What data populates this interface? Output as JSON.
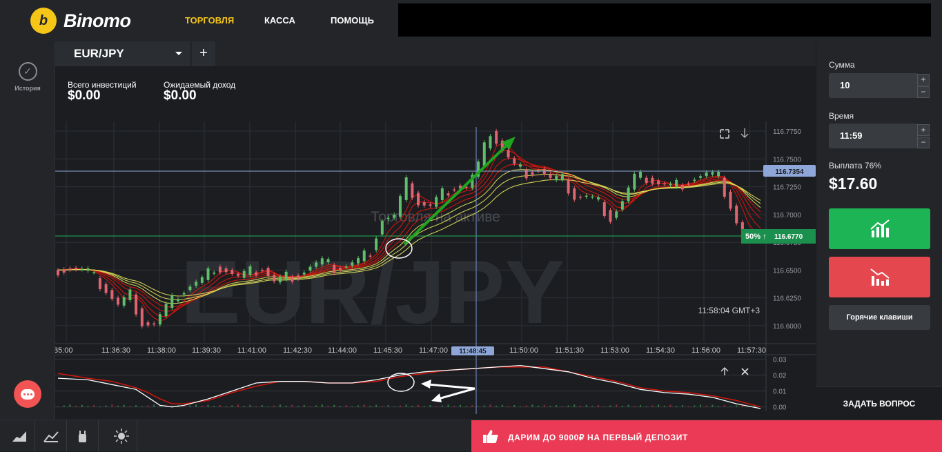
{
  "brand": {
    "name": "Binomo",
    "logo_letter": "b"
  },
  "nav": {
    "items": [
      {
        "label": "ТОРГОВЛЯ",
        "active": true
      },
      {
        "label": "КАССА",
        "active": false
      },
      {
        "label": "ПОМОЩЬ",
        "active": false
      }
    ]
  },
  "sidebar": {
    "history_label": "История"
  },
  "tab": {
    "asset": "EUR/JPY",
    "add": "+"
  },
  "investments": {
    "total_label": "Всего инвестиций",
    "total_value": "$0.00",
    "expected_label": "Ожидаемый доход",
    "expected_value": "$0.00"
  },
  "chart": {
    "watermark": "EUR/JPY",
    "status_overlay": "Торговля на активе",
    "server_time": "11:58:04 GMT+3",
    "cursor_time": "11:48:45",
    "current_price": "116.6770",
    "payout_badge": "50% ↑",
    "crosshair_price": "116.7354"
  },
  "chart_data": {
    "type": "line",
    "title": "",
    "price_ticks": [
      "116.7750",
      "116.7500",
      "116.7250",
      "116.7000",
      "116.6750",
      "116.6500",
      "116.6250",
      "116.6000"
    ],
    "time_ticks": [
      "35:00",
      "11:36:30",
      "11:38:00",
      "11:39:30",
      "11:41:00",
      "11:42:30",
      "11:44:00",
      "11:45:30",
      "11:47:00",
      "11:50:00",
      "11:51:30",
      "11:53:00",
      "11:54:30",
      "11:56:00",
      "11:57:30"
    ],
    "ylim": [
      116.585,
      116.78
    ],
    "price_path": [
      [
        0,
        116.65
      ],
      [
        3,
        116.652
      ],
      [
        6,
        116.648
      ],
      [
        9,
        116.632
      ],
      [
        11,
        116.618
      ],
      [
        13,
        116.628
      ],
      [
        15,
        116.603
      ],
      [
        17,
        116.601
      ],
      [
        19,
        116.616
      ],
      [
        21,
        116.628
      ],
      [
        23,
        116.636
      ],
      [
        25,
        116.641
      ],
      [
        27,
        116.653
      ],
      [
        29,
        116.65
      ],
      [
        31,
        116.643
      ],
      [
        33,
        116.648
      ],
      [
        35,
        116.652
      ],
      [
        37,
        116.639
      ],
      [
        39,
        116.644
      ],
      [
        41,
        116.646
      ],
      [
        43,
        116.653
      ],
      [
        45,
        116.657
      ],
      [
        47,
        116.652
      ],
      [
        49,
        116.654
      ],
      [
        51,
        116.658
      ],
      [
        53,
        116.668
      ],
      [
        55,
        116.696
      ],
      [
        57,
        116.698
      ],
      [
        59,
        116.728
      ],
      [
        61,
        116.711
      ],
      [
        63,
        116.707
      ],
      [
        65,
        116.719
      ],
      [
        67,
        116.726
      ],
      [
        69,
        116.724
      ],
      [
        71,
        116.744
      ],
      [
        73,
        116.775
      ],
      [
        75,
        116.758
      ],
      [
        77,
        116.743
      ],
      [
        79,
        116.738
      ],
      [
        81,
        116.741
      ],
      [
        83,
        116.731
      ],
      [
        85,
        116.731
      ],
      [
        87,
        116.716
      ],
      [
        89,
        116.716
      ],
      [
        91,
        116.711
      ],
      [
        93,
        116.697
      ],
      [
        95,
        116.712
      ],
      [
        97,
        116.733
      ],
      [
        99,
        116.733
      ],
      [
        101,
        116.728
      ],
      [
        103,
        116.725
      ],
      [
        105,
        116.728
      ],
      [
        107,
        116.733
      ],
      [
        109,
        116.736
      ],
      [
        111,
        116.733
      ],
      [
        113,
        116.708
      ],
      [
        115,
        116.678
      ],
      [
        117,
        116.677
      ]
    ],
    "ema_colors": [
      "#d4160c",
      "#e0e05a"
    ],
    "oscillator": {
      "ticks": [
        "0.03",
        "0.02",
        "0.01",
        "0.00"
      ],
      "ylim": [
        -0.001,
        0.031
      ],
      "white_line": [
        [
          0,
          0.018
        ],
        [
          5,
          0.017
        ],
        [
          9,
          0.014
        ],
        [
          13,
          0.011
        ],
        [
          15,
          0.006
        ],
        [
          17,
          0.001
        ],
        [
          19,
          0.0
        ],
        [
          21,
          0.001
        ],
        [
          25,
          0.005
        ],
        [
          29,
          0.01
        ],
        [
          33,
          0.015
        ],
        [
          37,
          0.016
        ],
        [
          41,
          0.016
        ],
        [
          45,
          0.015
        ],
        [
          49,
          0.015
        ],
        [
          53,
          0.017
        ],
        [
          57,
          0.02
        ],
        [
          61,
          0.022
        ],
        [
          65,
          0.023
        ],
        [
          69,
          0.024
        ],
        [
          73,
          0.025
        ],
        [
          77,
          0.026
        ],
        [
          81,
          0.024
        ],
        [
          85,
          0.022
        ],
        [
          89,
          0.018
        ],
        [
          93,
          0.015
        ],
        [
          97,
          0.011
        ],
        [
          101,
          0.009
        ],
        [
          105,
          0.008
        ],
        [
          109,
          0.006
        ],
        [
          113,
          0.002
        ],
        [
          117,
          -0.001
        ]
      ],
      "red_line": [
        [
          0,
          0.021
        ],
        [
          5,
          0.018
        ],
        [
          9,
          0.016
        ],
        [
          13,
          0.012
        ],
        [
          15,
          0.009
        ],
        [
          17,
          0.005
        ],
        [
          19,
          0.002
        ],
        [
          21,
          0.002
        ],
        [
          25,
          0.004
        ],
        [
          29,
          0.009
        ],
        [
          33,
          0.013
        ],
        [
          37,
          0.016
        ],
        [
          41,
          0.016
        ],
        [
          45,
          0.015
        ],
        [
          49,
          0.015
        ],
        [
          53,
          0.016
        ],
        [
          57,
          0.019
        ],
        [
          61,
          0.021
        ],
        [
          65,
          0.023
        ],
        [
          69,
          0.024
        ],
        [
          73,
          0.025
        ],
        [
          77,
          0.025
        ],
        [
          81,
          0.025
        ],
        [
          85,
          0.022
        ],
        [
          89,
          0.019
        ],
        [
          93,
          0.016
        ],
        [
          97,
          0.012
        ],
        [
          101,
          0.01
        ],
        [
          105,
          0.009
        ],
        [
          109,
          0.007
        ],
        [
          113,
          0.004
        ],
        [
          117,
          0.0
        ]
      ]
    }
  },
  "trade": {
    "amount_label": "Сумма",
    "amount_value": "10",
    "time_label": "Время",
    "time_value": "11:59",
    "payout_label": "Выплата 76%",
    "payout_value": "$17.60",
    "hotkeys_label": "Горячие клавиши",
    "ask_label": "ЗАДАТЬ ВОПРОС",
    "plus": "+",
    "minus": "−"
  },
  "promo": {
    "text": "ДАРИМ ДО 9000₽ НА ПЕРВЫЙ ДЕПОЗИТ"
  },
  "colors": {
    "up": "#1cb454",
    "down": "#e5474e",
    "brand": "#f5c518",
    "promo": "#ea3a55"
  }
}
